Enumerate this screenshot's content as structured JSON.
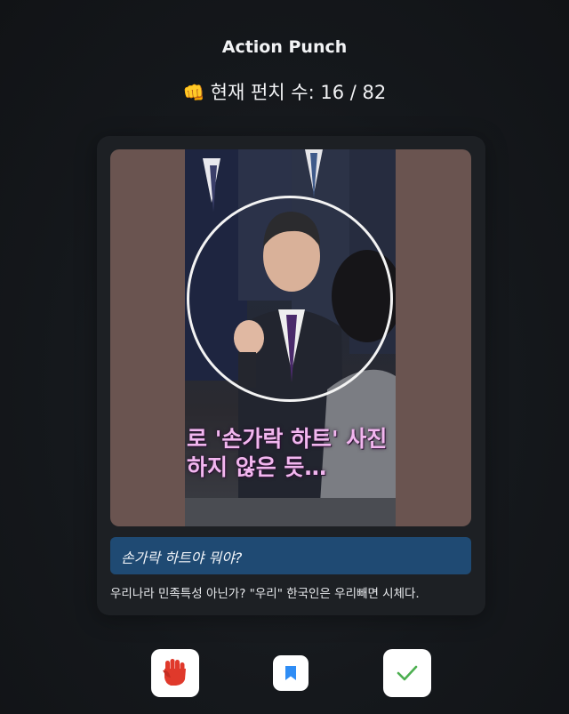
{
  "header": {
    "title": "Action Punch",
    "punch_icon": "👊",
    "punch_label": "현재 펀치 수: 16 / 82"
  },
  "card": {
    "video_caption_lines": [
      "로 '손가락 하트' 사진",
      "하지 않은 듯…"
    ],
    "question": "손가락 하트야 뭐야?",
    "comment": "우리나라 민족특성 아닌가? \"우리\" 한국인은 우리빼면 시체다."
  },
  "actions": {
    "punch_icon": "raised-fist-icon",
    "bookmark_icon": "bookmark-icon",
    "confirm_icon": "checkmark-icon"
  },
  "colors": {
    "accent_blue": "#1f4a73",
    "punch_red": "#e0392b",
    "bookmark_blue": "#2f8df5",
    "check_green": "#4caf50"
  }
}
